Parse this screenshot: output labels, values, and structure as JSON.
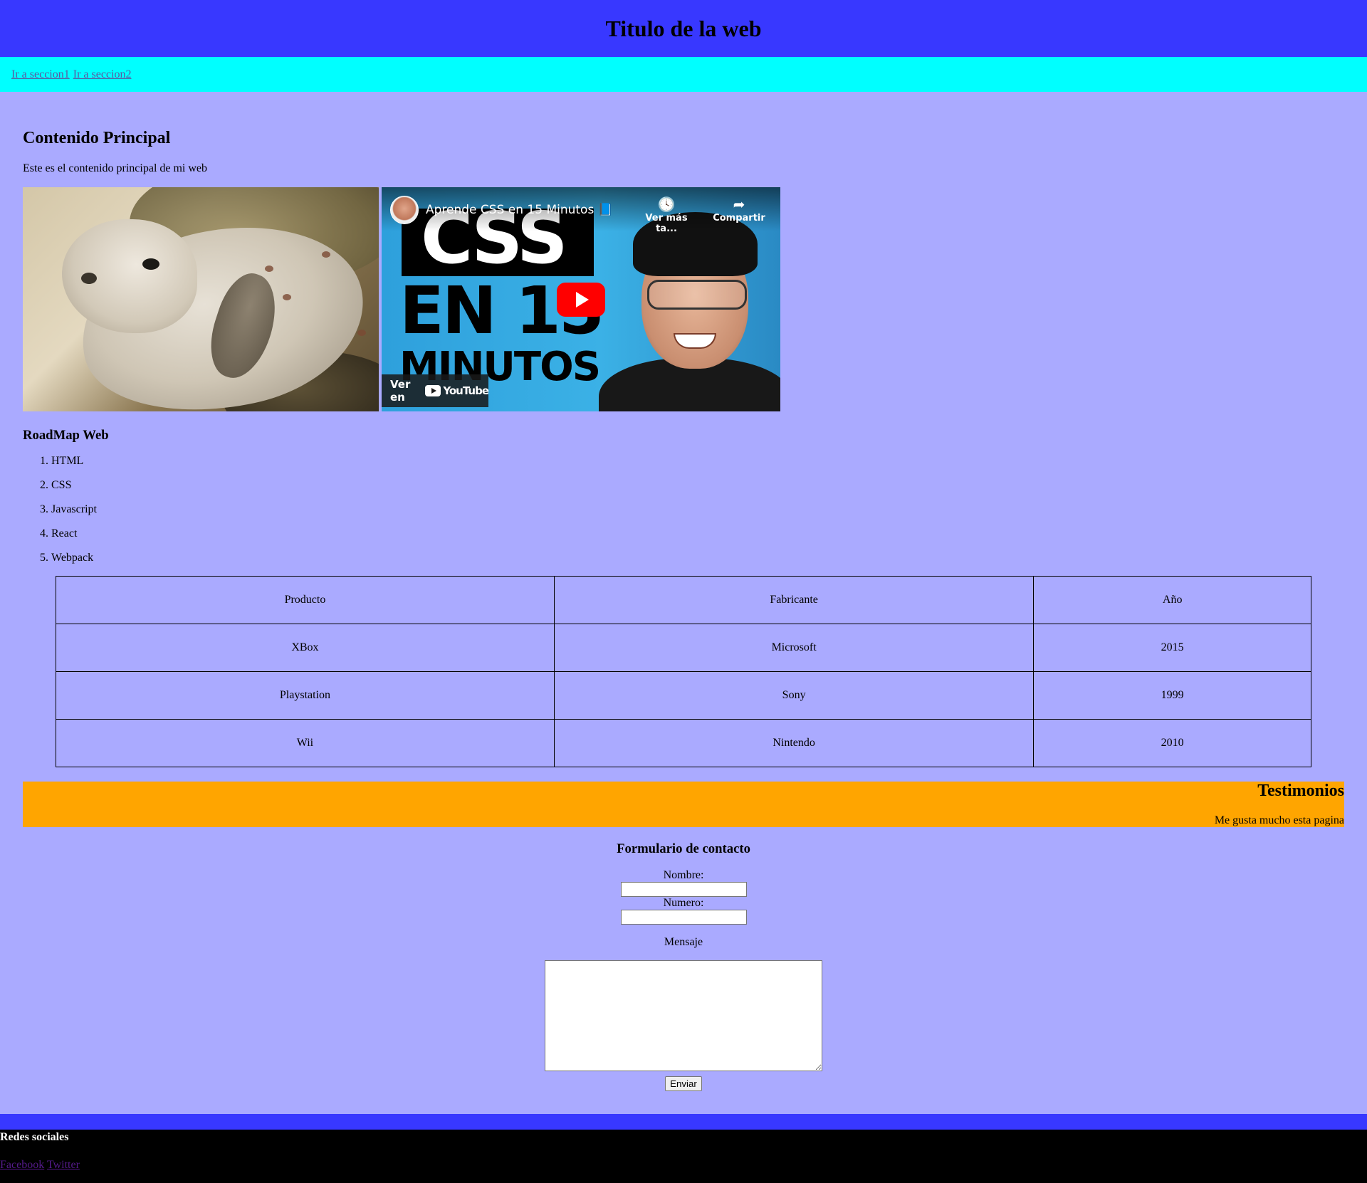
{
  "header": {
    "title": "Titulo de la web"
  },
  "nav": {
    "links": [
      {
        "label": "Ir a seccion1"
      },
      {
        "label": "Ir a seccion2"
      }
    ]
  },
  "main": {
    "heading": "Contenido Principal",
    "intro": "Este es el contenido principal de mi web",
    "video": {
      "title": "Aprende CSS en 15 Minutos 📘",
      "thumb_line1": "CSS",
      "thumb_line2": "EN 15",
      "thumb_line3": "MINUTOS",
      "watch_later": "Ver más ta...",
      "share": "Compartir",
      "watch_on": "Ver en",
      "yt_brand": "YouTube"
    },
    "roadmap": {
      "heading": "RoadMap Web",
      "items": [
        "HTML",
        "CSS",
        "Javascript",
        "React",
        "Webpack"
      ]
    },
    "table": {
      "header": [
        "Producto",
        "Fabricante",
        "Año"
      ],
      "rows": [
        [
          "XBox",
          "Microsoft",
          "2015"
        ],
        [
          "Playstation",
          "Sony",
          "1999"
        ],
        [
          "Wii",
          "Nintendo",
          "2010"
        ]
      ]
    }
  },
  "testimonials": {
    "heading": "Testimonios",
    "text": "Me gusta mucho esta pagina"
  },
  "contact": {
    "heading": "Formulario de contacto",
    "name_label": "Nombre:",
    "name_value": "",
    "number_label": "Numero:",
    "number_value": "",
    "message_label": "Mensaje",
    "message_value": "",
    "submit_label": "Enviar"
  },
  "footer": {
    "heading": "Redes sociales",
    "links": [
      {
        "label": "Facebook"
      },
      {
        "label": "Twitter"
      }
    ]
  },
  "colors": {
    "header_bg": "#3838ff",
    "nav_bg": "#00ffff",
    "page_bg": "#aaaaff",
    "testimonials_bg": "#ffa500",
    "footer_bg": "#000000"
  }
}
